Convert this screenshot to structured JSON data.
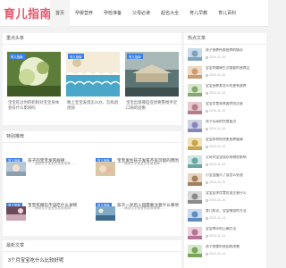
{
  "site": {
    "logo": "育儿指南"
  },
  "nav": [
    {
      "label": "首页"
    },
    {
      "label": "孕婴营养"
    },
    {
      "label": "孕检准备"
    },
    {
      "label": "父母必读"
    },
    {
      "label": "起名大全"
    },
    {
      "label": "育儿早教"
    },
    {
      "label": "育儿百科"
    }
  ],
  "banner": {
    "title": "重点头条",
    "items": [
      {
        "tag": "育儿指南",
        "title": "宝宝吃过时的奶粉对宝宝身体会有什么影响吗"
      },
      {
        "tag": "育儿指南",
        "title": "晚上宝宝发烧怎么办，怎样退烧快"
      },
      {
        "tag": "育儿指南",
        "title": "宝宝出现哪些症状要警惕手足口病的迹象"
      }
    ]
  },
  "recommend": {
    "title": "特别推荐",
    "items": [
      {
        "tag": "育儿指南",
        "title": "孩子的宝宝发育规律"
      },
      {
        "tag": "育儿指南",
        "title": "宝宝发生孩子发育不良可能的原因"
      },
      {
        "tag": "育儿指南",
        "title": "宝宝有哪些不该吃什么食物"
      },
      {
        "tag": "育儿指南",
        "title": "孩子一岁后入园需要注意什么事项"
      }
    ],
    "snippets": [
      "……摘录文字宝宝的发育规律……",
      "……摘录文字宝宝的发育规律……",
      "……摘录文字宝宝的发育规律……",
      "……摘录文字宝宝的发育规律……"
    ]
  },
  "latest": {
    "title": "最新文章",
    "items": [
      {
        "title": "3个月宝宝吃什么比较好呢"
      }
    ]
  },
  "hot": {
    "title": "热点文章",
    "items": [
      {
        "title": "孩子营养所需营养的情况",
        "date": "2024-11-16"
      },
      {
        "title": "宝宝的健康生活需要的营养品",
        "date": "2024-11-16"
      },
      {
        "title": "宝宝营养素怎么吃更有营养",
        "date": "2024-11-16"
      },
      {
        "title": "宝宝饮食营养要特别注意",
        "date": "2024-11-15"
      },
      {
        "title": "孩子长高的饮食要点",
        "date": "2024-11-15"
      },
      {
        "title": "宝宝如何吃得更营养健康",
        "date": "2024-11-15"
      },
      {
        "title": "父母对宝宝成长有哪些影响",
        "date": "2024-11-15"
      },
      {
        "title": "小宝宝腹泻了该怎么处理",
        "date": "2024-11-15"
      },
      {
        "title": "宝宝夏季饮食应该注意什么",
        "date": "2024-11-14"
      },
      {
        "title": "育儿知识，宝宝睡觉的方法",
        "date": "2024-11-14"
      },
      {
        "title": "宝宝喝水的正确方法",
        "date": "2024-11-14"
      },
      {
        "title": "孩子挑食的原因和改善",
        "date": "2024-11-14"
      }
    ]
  },
  "colors": {
    "brand": "#e8546a",
    "tag": "#3b7ee6",
    "bg": "#f2f2f2"
  }
}
